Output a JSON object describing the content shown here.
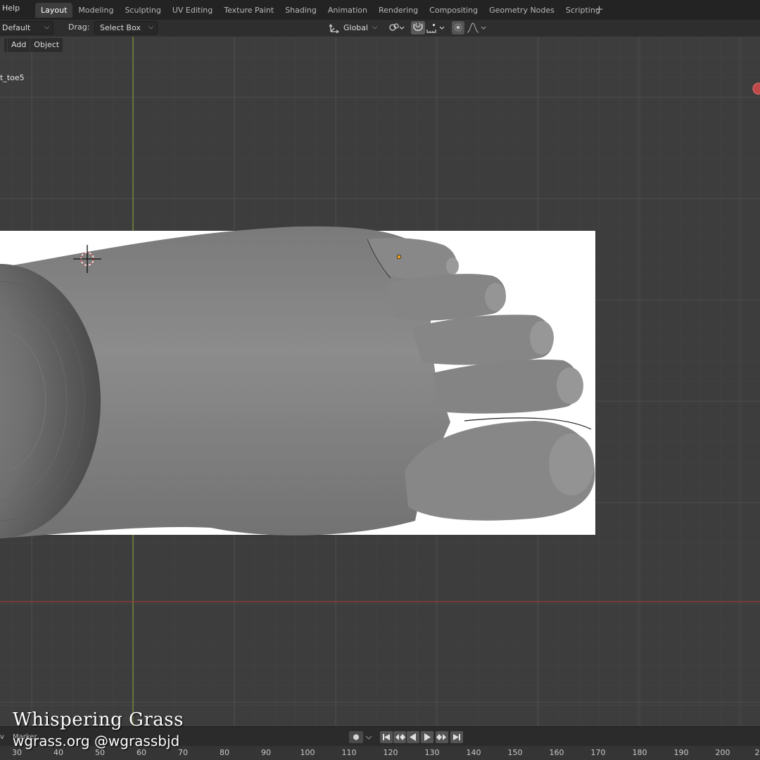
{
  "topbar": {
    "help": "Help",
    "tabs": [
      "Layout",
      "Modeling",
      "Sculpting",
      "UV Editing",
      "Texture Paint",
      "Shading",
      "Animation",
      "Rendering",
      "Compositing",
      "Geometry Nodes",
      "Scripting"
    ],
    "active_tab": "Layout",
    "add_workspace": "+"
  },
  "toolheader": {
    "orientation": "Default",
    "drag_label": "Drag:",
    "drag_value": "Select Box",
    "transform_orientation": "Global"
  },
  "viewport": {
    "menu": [
      "Add",
      "Object"
    ],
    "object_name": "t_toe5"
  },
  "timeline": {
    "view_label": "v",
    "marker_label": "Marker",
    "ticks": [
      "30",
      "40",
      "50",
      "60",
      "70",
      "80",
      "90",
      "100",
      "110",
      "120",
      "130",
      "140",
      "150",
      "160",
      "170",
      "180",
      "190",
      "200",
      "2"
    ]
  },
  "watermark": {
    "title": "Whispering Grass",
    "subtitle": "wgrass.org @wgrassbjd"
  },
  "colors": {
    "active_tab": "#3d3d3d",
    "grid_y_axis": "#7a9a3a",
    "grid_x_axis": "#9a3a3a",
    "reference_bg": "#ffffff",
    "mesh": "#8a8a8a"
  }
}
